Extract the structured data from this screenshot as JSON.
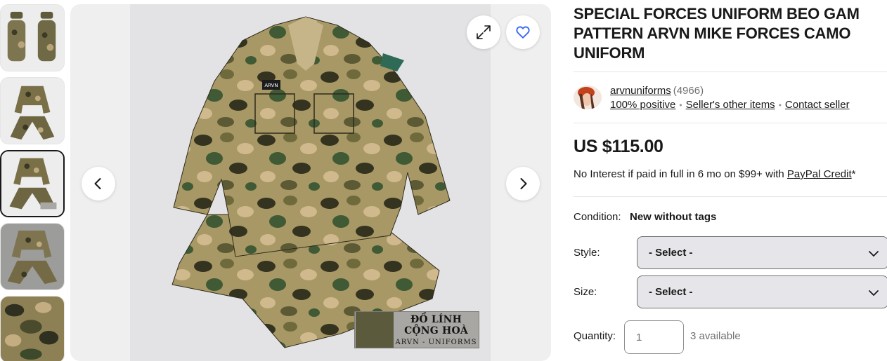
{
  "gallery": {
    "thumbnails": [
      {
        "alt": "Uniform on mannequins front and back"
      },
      {
        "alt": "Shirt and trousers laid flat"
      },
      {
        "alt": "Shirt and trousers with label",
        "active": true
      },
      {
        "alt": "Shirt and trousers on grey background"
      },
      {
        "alt": "Camouflage fabric close-up"
      }
    ],
    "watermark_title": "ĐỒ LÍNH CỘNG HOÀ",
    "watermark_subtitle": "ARVN - UNIFORMS",
    "badge_text": "ARVN"
  },
  "listing": {
    "title": "SPECIAL FORCES UNIFORM BEO GAM PATTERN ARVN MIKE FORCES CAMO UNIFORM",
    "price": "US $115.00",
    "credit_text": "No Interest if paid in full in 6 mo on $99+ with ",
    "credit_link": "PayPal Credit",
    "credit_suffix": "*"
  },
  "seller": {
    "name": "arvnuniforms",
    "feedback_count": "(4966)",
    "positive": "100% positive",
    "other_items": "Seller's other items",
    "contact": "Contact seller"
  },
  "details": {
    "condition_label": "Condition:",
    "condition_value": "New without tags",
    "style_label": "Style:",
    "style_value": "- Select -",
    "size_label": "Size:",
    "size_value": "- Select -",
    "quantity_label": "Quantity:",
    "quantity_placeholder": "1",
    "available": "3 available"
  },
  "icons": {
    "expand": "expand-icon",
    "favorite": "heart-icon",
    "prev": "chevron-left-icon",
    "next": "chevron-right-icon",
    "dropdown": "chevron-down-icon"
  },
  "colors": {
    "text": "#191919",
    "accent_blue": "#3665f3",
    "muted": "#707070"
  }
}
